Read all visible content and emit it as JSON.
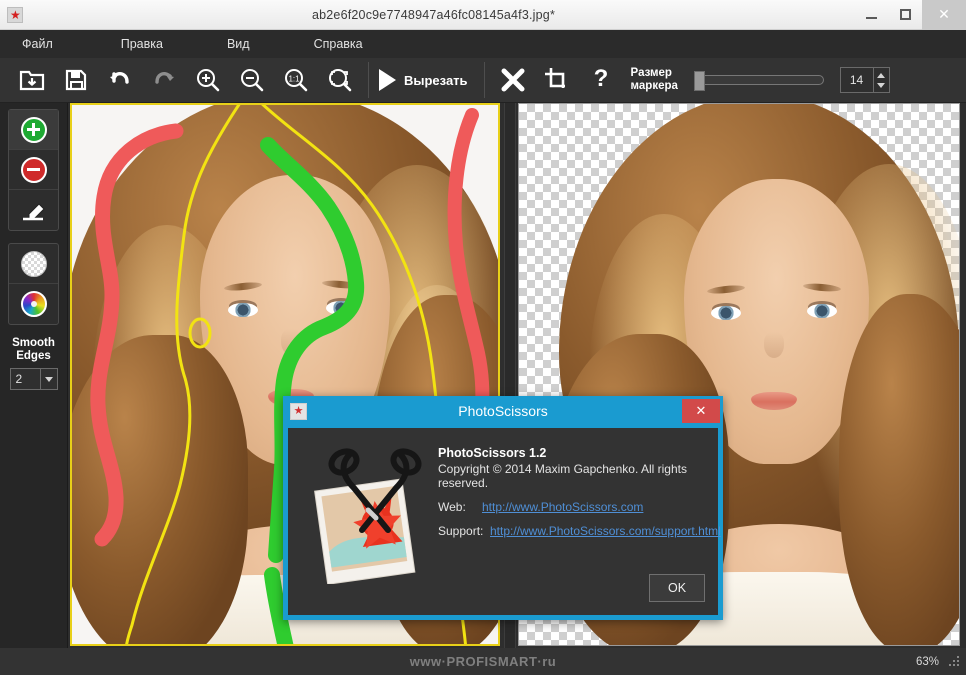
{
  "window": {
    "title": "ab2e6f20c9e7748947a46fc08145a4f3.jpg*",
    "icon": "app-star-icon",
    "minimize": "–",
    "maximize": "❐",
    "close": "✕"
  },
  "menu": {
    "items": [
      {
        "label": "Файл"
      },
      {
        "label": "Правка"
      },
      {
        "label": "Вид"
      },
      {
        "label": "Справка"
      }
    ]
  },
  "toolbar": {
    "open_icon": "open-folder-icon",
    "save_icon": "save-disk-icon",
    "undo_icon": "undo-arrow-icon",
    "redo_icon": "redo-arrow-icon",
    "zoom_in_icon": "zoom-in-icon",
    "zoom_out_icon": "zoom-out-icon",
    "zoom_actual_icon": "zoom-1to1-icon",
    "zoom_fit_icon": "zoom-fit-icon",
    "cut_label": "Вырезать",
    "cut_icon": "play-triangle-icon",
    "clear_icon": "clear-cross-icon",
    "crop_icon": "crop-icon",
    "help_icon": "question-mark-icon",
    "marker_size_label_line1": "Размер",
    "marker_size_label_line2": "маркера",
    "marker_size_value": "14",
    "marker_slider_percent": 2
  },
  "tools": {
    "foreground": {
      "name": "mark-foreground-tool",
      "icon": "green-plus-circle-icon"
    },
    "background": {
      "name": "mark-background-tool",
      "icon": "red-minus-circle-icon"
    },
    "eraser": {
      "name": "eraser-tool",
      "icon": "eraser-icon"
    },
    "transparent_bg": {
      "name": "transparent-background-tool",
      "icon": "checkerboard-circle-icon"
    },
    "color_bg": {
      "name": "color-background-tool",
      "icon": "color-wheel-icon"
    },
    "smooth_edges_label_line1": "Smooth",
    "smooth_edges_label_line2": "Edges",
    "smooth_edges_value": "2"
  },
  "canvas": {
    "left_pane_name": "source-image-pane",
    "right_pane_name": "result-image-pane",
    "selection_border_color": "#e8d018",
    "foreground_stroke_color": "#2fcc2f",
    "background_stroke_color": "#ef5a5a",
    "divider_name": "pane-splitter"
  },
  "status": {
    "zoom": "63%",
    "watermark": "www·PROFISMART·ru"
  },
  "dialog": {
    "title": "PhotoScissors",
    "icon": "app-star-icon",
    "close": "✕",
    "app_name_version": "PhotoScissors 1.2",
    "copyright": "Copyright © 2014 Maxim Gapchenko. All rights reserved.",
    "web_label": "Web:",
    "web_url": "http://www.PhotoScissors.com",
    "support_label": "Support:",
    "support_url": "http://www.PhotoScissors.com/support.html",
    "ok_label": "OK",
    "art_icon": "scissors-photo-icon",
    "accent_color": "#1a9bd0",
    "close_color": "#d24a4a"
  }
}
